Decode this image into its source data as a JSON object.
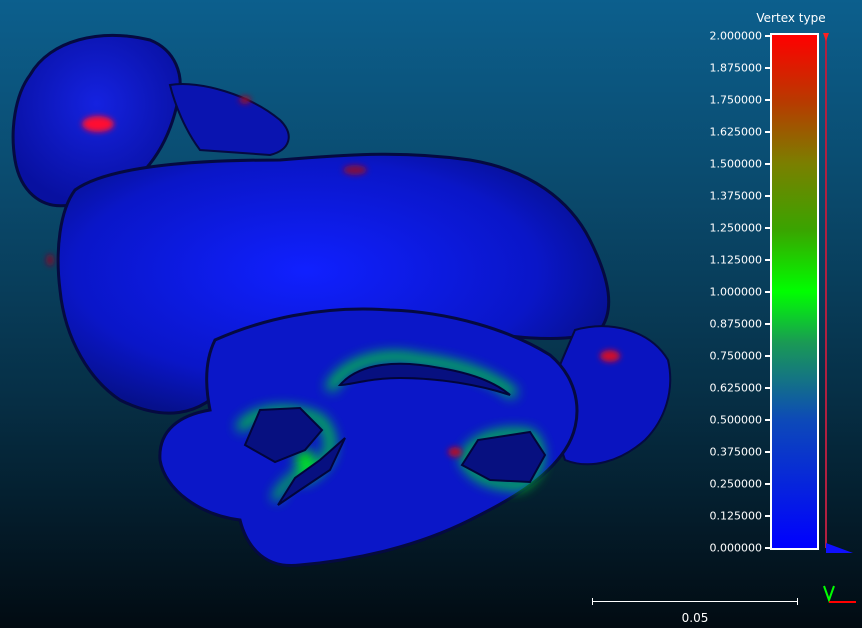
{
  "scalar_field": {
    "title": "Vertex type",
    "ticks": [
      {
        "value": 2.0,
        "label": "2.000000"
      },
      {
        "value": 1.875,
        "label": "1.875000"
      },
      {
        "value": 1.75,
        "label": "1.750000"
      },
      {
        "value": 1.625,
        "label": "1.625000"
      },
      {
        "value": 1.5,
        "label": "1.500000"
      },
      {
        "value": 1.375,
        "label": "1.375000"
      },
      {
        "value": 1.25,
        "label": "1.250000"
      },
      {
        "value": 1.125,
        "label": "1.125000"
      },
      {
        "value": 1.0,
        "label": "1.000000"
      },
      {
        "value": 0.875,
        "label": "0.875000"
      },
      {
        "value": 0.75,
        "label": "0.750000"
      },
      {
        "value": 0.625,
        "label": "0.625000"
      },
      {
        "value": 0.5,
        "label": "0.500000"
      },
      {
        "value": 0.375,
        "label": "0.375000"
      },
      {
        "value": 0.25,
        "label": "0.250000"
      },
      {
        "value": 0.125,
        "label": "0.125000"
      },
      {
        "value": 0.0,
        "label": "0.000000"
      }
    ],
    "range": [
      0,
      2
    ],
    "colors": {
      "min": "#0000ff",
      "mid": "#00ff00",
      "max": "#ff0000"
    }
  },
  "scale_bar": {
    "label": "0.05"
  },
  "axes": {
    "x_color": "#ff0000",
    "y_color": "#00ff00"
  },
  "background": {
    "top": "#0c5f8d",
    "bottom": "#020b12"
  }
}
